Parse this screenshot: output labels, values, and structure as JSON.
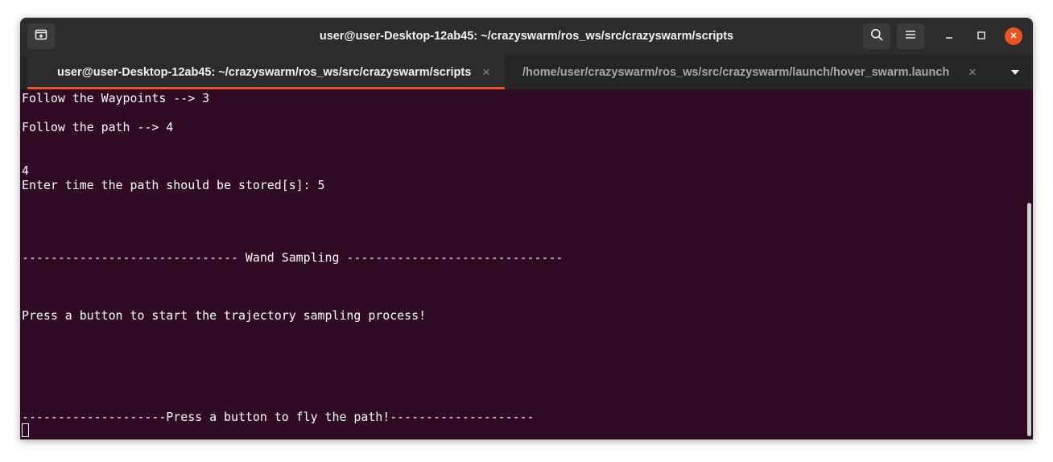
{
  "window": {
    "title": "user@user-Desktop-12ab45: ~/crazyswarm/ros_ws/src/crazyswarm/scripts"
  },
  "icons": {
    "new_tab": "new-tab-icon",
    "search": "search-icon",
    "menu": "hamburger-menu-icon",
    "minimize": "minimize-icon",
    "maximize": "maximize-icon",
    "close": "close-icon",
    "tab_close": "close-icon",
    "tab_dropdown": "chevron-down-icon"
  },
  "tabs": [
    {
      "label": "user@user-Desktop-12ab45: ~/crazyswarm/ros_ws/src/crazyswarm/scripts",
      "close": "×",
      "active": true
    },
    {
      "label": "/home/user/crazyswarm/ros_ws/src/crazyswarm/launch/hover_swarm.launch",
      "close": "×",
      "active": false
    }
  ],
  "terminal": {
    "output": "Follow the Waypoints --> 3\n\nFollow the path --> 4\n\n\n4\nEnter time the path should be stored[s]: 5\n\n\n\n\n------------------------------ Wand Sampling ------------------------------\n\n\n\nPress a button to start the trajectory sampling process!\n\n\n\n\n\n\n--------------------Press a button to fly the path!--------------------"
  },
  "colors": {
    "terminal_bg": "#300a24",
    "headerbar_bg": "#2c2c2c",
    "tabbar_bg": "#252525",
    "accent": "#e95420",
    "close_button": "#e95420"
  }
}
